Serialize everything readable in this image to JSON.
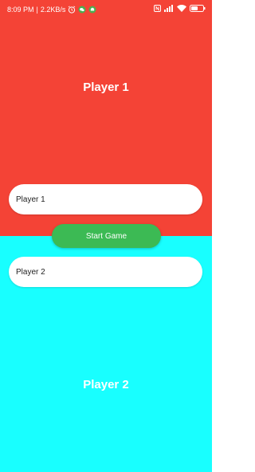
{
  "status_bar": {
    "time": "8:09 PM",
    "separator": "|",
    "data_speed": "2.2KB/s",
    "battery_level": "46",
    "icons": [
      "alarm-icon",
      "wechat-icon",
      "android-icon",
      "nfc-icon",
      "signal-icon",
      "wifi-icon",
      "battery-icon"
    ]
  },
  "top_half": {
    "background_color": "#f44336",
    "heading": "Player 1",
    "input_value": "Player 1"
  },
  "start_button": {
    "label": "Start Game",
    "color": "#3cba54"
  },
  "bottom_half": {
    "background_color": "#18ffff",
    "heading": "Player 2",
    "input_value": "Player 2"
  }
}
